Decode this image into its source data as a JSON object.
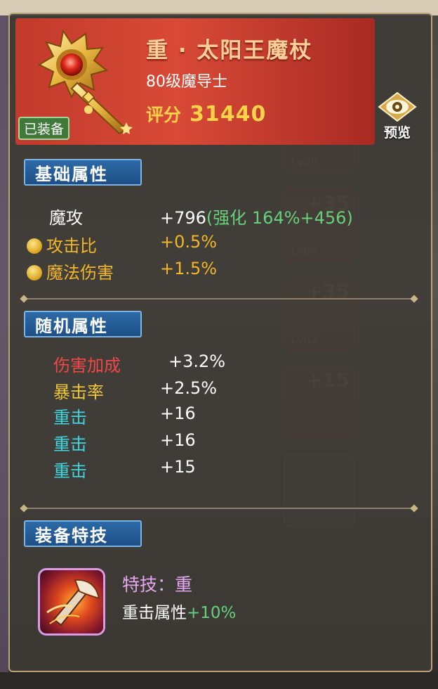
{
  "item": {
    "name": "重 · 太阳王魔杖",
    "level": "80级",
    "class": "魔导士",
    "score_label": "评分",
    "score": "31440",
    "equipped_badge": "已装备"
  },
  "preview": {
    "label": "预览",
    "icon": "eye-icon"
  },
  "sections": {
    "basic": "基础属性",
    "random": "随机属性",
    "skill": "装备特技"
  },
  "basic_stats": [
    {
      "name": "魔攻",
      "value": "+796",
      "extra": "(强化 164%+456)",
      "coin": false
    },
    {
      "name": "攻击比",
      "value": "+0.5%",
      "coin": true
    },
    {
      "name": "魔法伤害",
      "value": "+1.5%",
      "coin": true
    }
  ],
  "random_stats": [
    {
      "name": "伤害加成",
      "value": "+3.2%"
    },
    {
      "name": "暴击率",
      "value": "+2.5%"
    },
    {
      "name": "重击",
      "value": "+16"
    },
    {
      "name": "重击",
      "value": "+16"
    },
    {
      "name": "重击",
      "value": "+15"
    }
  ],
  "skill": {
    "name": "特技：重",
    "desc_label": "重击属性",
    "desc_value": "+10%"
  },
  "colors": {
    "title": "#ffcf9a",
    "score": "#ffd24a",
    "gold_stat": "#f2b62a",
    "green": "#66d17a",
    "red_stat": "#f04848",
    "yellow_stat": "#f0c83a",
    "cyan_stat": "#3fd6e0",
    "skill": "#e6a7f2"
  }
}
